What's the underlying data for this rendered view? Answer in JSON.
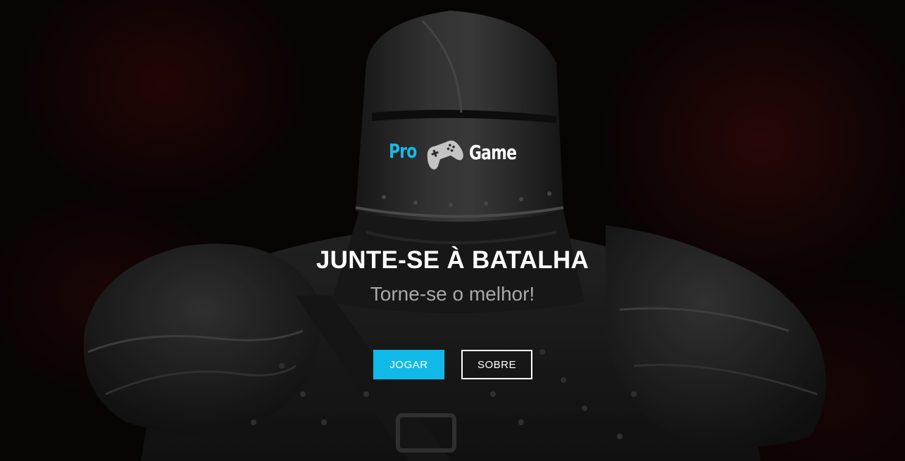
{
  "logo": {
    "left_text": "Pro",
    "right_text": "Game",
    "icon": "gamepad-icon",
    "left_color": "#18b8e6",
    "right_color": "#ffffff"
  },
  "hero": {
    "title": "JUNTE-SE À BATALHA",
    "subtitle": "Torne-se o melhor!",
    "background_image": "armored-knight-image"
  },
  "buttons": {
    "play_label": "JOGAR",
    "about_label": "SOBRE",
    "accent_color": "#11b9e8"
  }
}
